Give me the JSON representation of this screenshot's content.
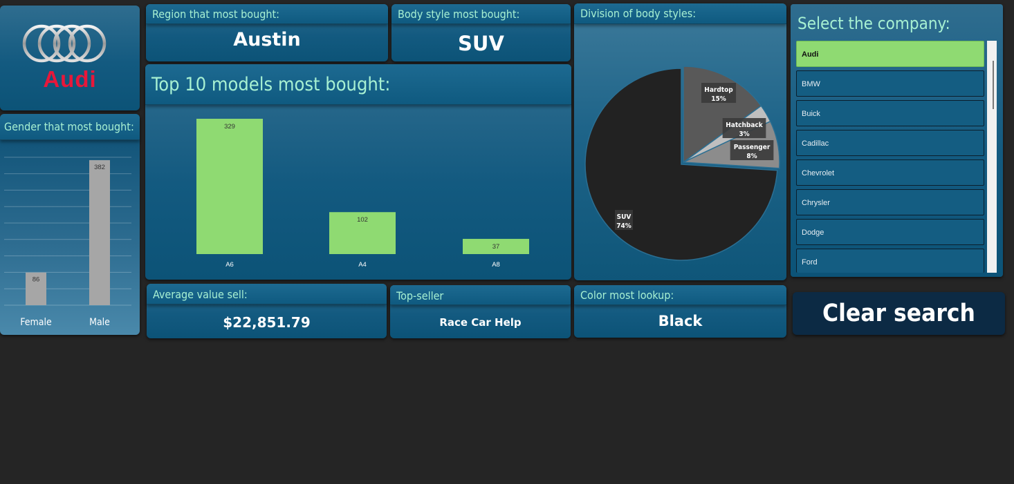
{
  "logo": {
    "brand_name": "Audi"
  },
  "region": {
    "title": "Region that most bought:",
    "value": "Austin"
  },
  "body_style": {
    "title": "Body style most bought:",
    "value": "SUV"
  },
  "top_models": {
    "title": "Top 10 models most bought:"
  },
  "division": {
    "title": "Division of body styles:"
  },
  "gender": {
    "title": "Gender that most bought:"
  },
  "average": {
    "title": "Average value sell:",
    "value": "$22,851.79"
  },
  "top_seller": {
    "title": "Top-seller",
    "value": "Race Car Help"
  },
  "color": {
    "title": "Color most lookup:",
    "value": "Black"
  },
  "company_slicer": {
    "title": "Select the company:",
    "items": [
      "Audi",
      "BMW",
      "Buick",
      "Cadillac",
      "Chevrolet",
      "Chrysler",
      "Dodge",
      "Ford"
    ],
    "selected": "Audi"
  },
  "clear_button": {
    "label": "Clear search"
  },
  "colors": {
    "accent_green": "#8fda72",
    "header_text": "#a7f0d2",
    "card_blue": "#135a80",
    "bar_gray": "#a6a6a6",
    "logo_red": "#e8173a"
  },
  "chart_data": [
    {
      "type": "bar",
      "id": "top-models",
      "categories": [
        "A6",
        "A4",
        "A8"
      ],
      "values": [
        329,
        102,
        37
      ],
      "ylim": [
        0,
        329
      ],
      "grid": false
    },
    {
      "type": "bar",
      "id": "gender",
      "categories": [
        "Female",
        "Male"
      ],
      "values": [
        86,
        382
      ],
      "ylim": [
        0,
        400
      ],
      "grid": true
    },
    {
      "type": "pie",
      "id": "body-styles",
      "categories": [
        "Hardtop",
        "Hatchback",
        "Passenger",
        "SUV"
      ],
      "values": [
        15,
        3,
        8,
        74
      ],
      "labels": [
        "15%",
        "3%",
        "8%",
        "74%"
      ]
    }
  ]
}
